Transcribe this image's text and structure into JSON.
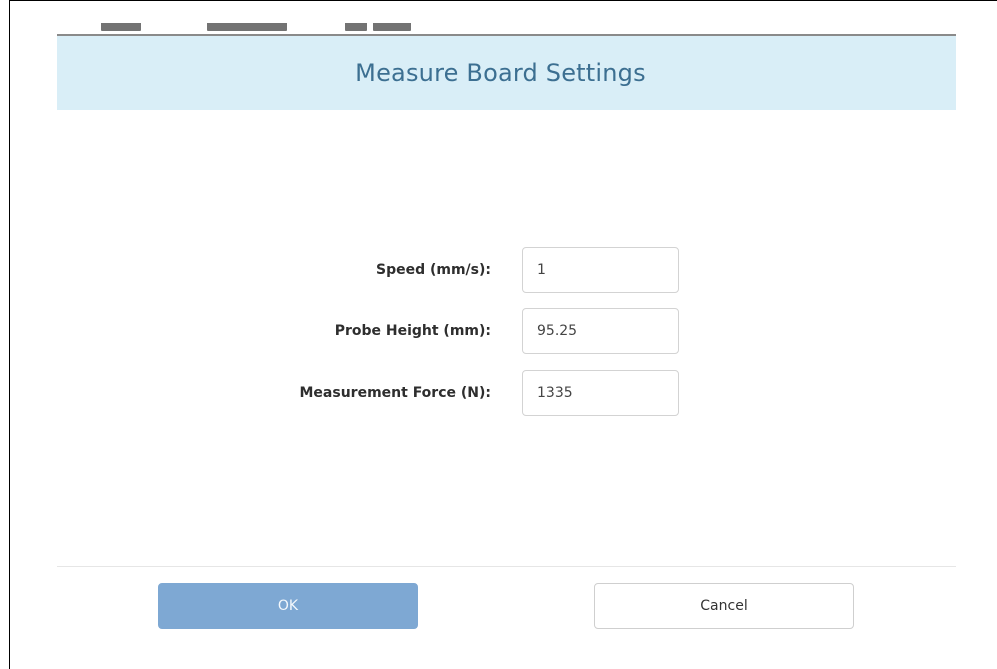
{
  "dialog": {
    "title": "Measure Board Settings"
  },
  "fields": [
    {
      "label": "Speed (mm/s):",
      "value": "1"
    },
    {
      "label": "Probe Height (mm):",
      "value": "95.25"
    },
    {
      "label": "Measurement Force (N):",
      "value": "1335"
    }
  ],
  "buttons": {
    "ok_label": "OK",
    "cancel_label": "Cancel"
  },
  "colors": {
    "header_background": "#d9eef7",
    "title_text": "#3c6f91",
    "ok_button": "#7ea8d3",
    "cancel_border": "#cfcfcf"
  }
}
